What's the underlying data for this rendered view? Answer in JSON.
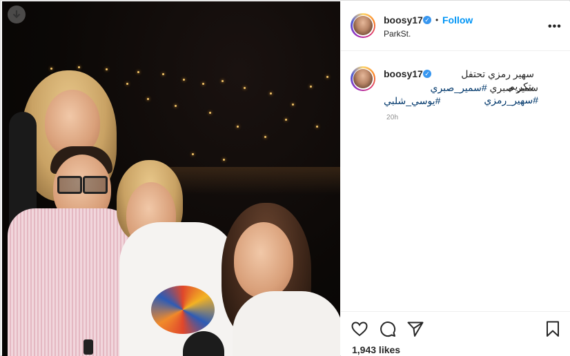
{
  "post": {
    "username": "boosy17",
    "verified_badge": "✓",
    "separator": "•",
    "follow_label": "Follow",
    "location": "ParkSt.",
    "more_label": "•••"
  },
  "caption": {
    "username": "boosy17",
    "verified_badge": "✓",
    "text": "سهير رمزي تحتفل بتكريم",
    "line2_text": "سمير صبري",
    "hashtags_line2": "#سمير_صبري #سهير_رمزي",
    "hashtag_line3": "#يوسي_شلبي",
    "time": "20h"
  },
  "actions": {
    "like_icon": "heart-icon",
    "comment_icon": "comment-icon",
    "share_icon": "paper-plane-icon",
    "save_icon": "bookmark-icon",
    "likes_text": "1,943 likes"
  },
  "photo": {
    "download_icon": "download-arrow-icon"
  },
  "colors": {
    "link": "#0095f6",
    "hashtag": "#00376b",
    "muted": "#8e8e8e",
    "verified": "#3897f0"
  }
}
